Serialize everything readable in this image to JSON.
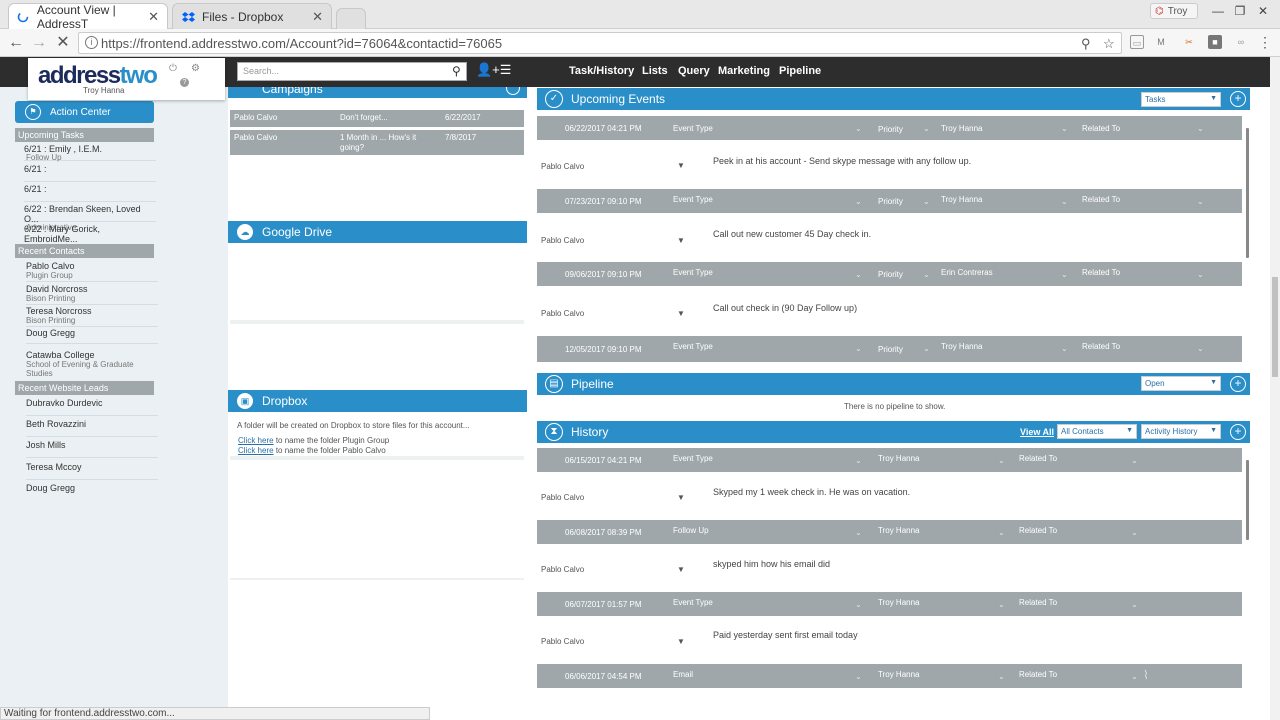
{
  "browser": {
    "tabs": [
      {
        "title": "Account View | AddressT",
        "active": true
      },
      {
        "title": "Files - Dropbox",
        "active": false
      }
    ],
    "user_chip": "Troy",
    "url": "https://frontend.addresstwo.com/Account?id=76064&contactid=76065",
    "status": "Waiting for frontend.addresstwo.com..."
  },
  "header": {
    "logo_part1": "address",
    "logo_part2": "two",
    "user": "Troy Hanna",
    "search_placeholder": "Search...",
    "nav": [
      "Task/History",
      "Lists",
      "Query",
      "Marketing",
      "Pipeline"
    ]
  },
  "sidebar": {
    "action_center": "Action Center",
    "upcoming_tasks_label": "Upcoming Tasks",
    "tasks": [
      {
        "date": "6/21 :",
        "name": "Emily , I.E.M.",
        "sub": "Follow Up"
      },
      {
        "date": "6/21 :",
        "name": "",
        "sub": ""
      },
      {
        "date": "6/21 :",
        "name": "",
        "sub": ""
      },
      {
        "date": "6/22 :",
        "name": "Brendan Skeen, Loved O...",
        "sub": "Administrative"
      },
      {
        "date": "6/22 :",
        "name": "Mary Gorick, EmbroidMe...",
        "sub": ""
      }
    ],
    "recent_contacts_label": "Recent Contacts",
    "contacts": [
      {
        "name": "Pablo Calvo",
        "sub": "Plugin Group"
      },
      {
        "name": "David Norcross",
        "sub": "Bison Printing"
      },
      {
        "name": "Teresa Norcross",
        "sub": "Bison Printing"
      },
      {
        "name": "Doug Gregg",
        "sub": ""
      },
      {
        "name": "Catawba College",
        "sub": "School of Evening & Graduate Studies"
      }
    ],
    "recent_leads_label": "Recent Website Leads",
    "leads": [
      "Dubravko Durdevic",
      "Beth Rovazzini",
      "Josh Mills",
      "Teresa Mccoy",
      "Doug Gregg"
    ]
  },
  "campaigns": {
    "title": "Campaigns",
    "rows": [
      {
        "contact": "Pablo Calvo",
        "name": "Don't forget...",
        "date": "6/22/2017"
      },
      {
        "contact": "Pablo Calvo",
        "name": "1 Month in ... How's it going?",
        "date": "7/8/2017"
      }
    ]
  },
  "google_drive": {
    "title": "Google Drive"
  },
  "dropbox": {
    "title": "Dropbox",
    "text": "A folder will be created on Dropbox to store files for this account...",
    "link1": "Click here",
    "link1_rest": "to name the folder Plugin Group",
    "link2": "Click here",
    "link2_rest": "to name the folder Pablo Calvo"
  },
  "upcoming": {
    "title": "Upcoming Events",
    "filter": "Tasks",
    "events": [
      {
        "datetime": "06/22/2017 04:21 PM",
        "type": "Event Type",
        "priority": "Priority",
        "owner": "Troy Hanna",
        "related": "Related To",
        "contact": "Pablo Calvo",
        "desc": "Peek in at his account - Send skype message with any follow up."
      },
      {
        "datetime": "07/23/2017 09:10 PM",
        "type": "Event Type",
        "priority": "Priority",
        "owner": "Troy Hanna",
        "related": "Related To",
        "contact": "Pablo Calvo",
        "desc": "Call out new customer 45 Day check in."
      },
      {
        "datetime": "09/06/2017 09:10 PM",
        "type": "Event Type",
        "priority": "Priority",
        "owner": "Erin Contreras",
        "related": "Related To",
        "contact": "Pablo Calvo",
        "desc": "Call out check in (90 Day Follow up)"
      },
      {
        "datetime": "12/05/2017 09:10 PM",
        "type": "Event Type",
        "priority": "Priority",
        "owner": "Troy Hanna",
        "related": "Related To",
        "contact": "",
        "desc": ""
      }
    ]
  },
  "pipeline": {
    "title": "Pipeline",
    "filter": "Open",
    "empty": "There is no pipeline to show."
  },
  "history": {
    "title": "History",
    "view_all": "View All",
    "filter1": "All Contacts",
    "filter2": "Activity History",
    "items": [
      {
        "datetime": "06/15/2017 04:21 PM",
        "type": "Event Type",
        "owner": "Troy Hanna",
        "related": "Related To",
        "contact": "Pablo Calvo",
        "desc": "Skyped my 1 week check in.  He was on vacation."
      },
      {
        "datetime": "06/08/2017 08:39 PM",
        "type": "Follow Up",
        "owner": "Troy Hanna",
        "related": "Related To",
        "contact": "Pablo Calvo",
        "desc": "skyped him how his email did"
      },
      {
        "datetime": "06/07/2017 01:57 PM",
        "type": "Event Type",
        "owner": "Troy Hanna",
        "related": "Related To",
        "contact": "Pablo Calvo",
        "desc": "Paid yesterday sent first email today"
      },
      {
        "datetime": "06/06/2017 04:54 PM",
        "type": "Email",
        "owner": "Troy Hanna",
        "related": "Related To",
        "contact": "",
        "desc": ""
      }
    ]
  },
  "colors": {
    "accent": "#2a8fc9",
    "header": "#2d2d2d",
    "row": "#9fa7ab"
  }
}
